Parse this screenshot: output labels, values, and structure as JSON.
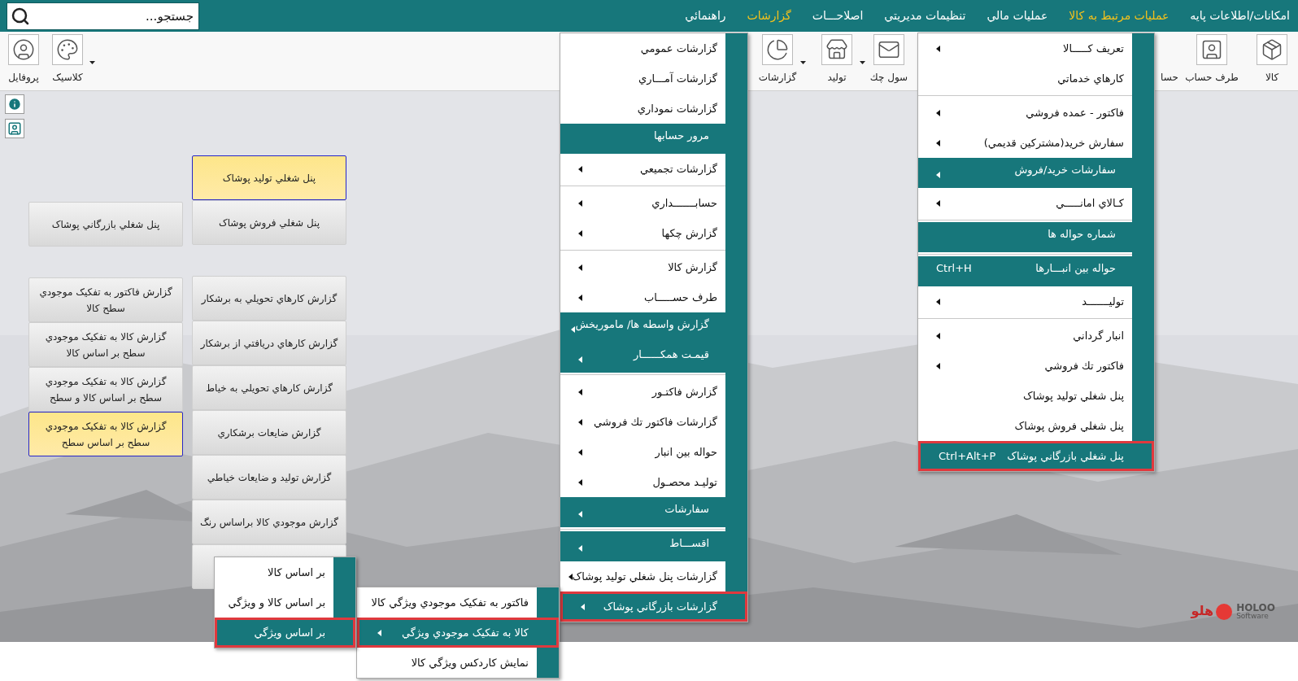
{
  "top_menu": [
    {
      "label": "امکانات/اطلاعات پايه",
      "active": false
    },
    {
      "label": "عمليات مرتبط به كالا",
      "active": true
    },
    {
      "label": "عمليات مالي",
      "active": false
    },
    {
      "label": "تنظيمات مديريتي",
      "active": false
    },
    {
      "label": "اصلاحـــات",
      "active": false
    },
    {
      "label": "گزارشات",
      "active": true
    },
    {
      "label": "راهنمائي",
      "active": false
    }
  ],
  "search": {
    "placeholder": "جستجو..."
  },
  "toolbar": {
    "right": [
      {
        "label": "كالا",
        "dropdown": false
      },
      {
        "label": "طرف حساب",
        "dropdown": false
      },
      {
        "label": "حسا",
        "dropdown": false
      },
      {
        "label": "سول چك",
        "dropdown": false
      },
      {
        "label": "توليد",
        "dropdown": true
      },
      {
        "label": "گزارشات",
        "dropdown": true
      }
    ],
    "left": [
      {
        "label": "كلاسيک",
        "dropdown": true
      },
      {
        "label": "پروفايل",
        "dropdown": false
      }
    ]
  },
  "panel_columns": [
    {
      "groups": [
        [
          {
            "kind": "button",
            "label": "پنل شغلي توليد پوشاک",
            "selected": true
          },
          {
            "kind": "button",
            "label": "پنل شغلي فروش پوشاک",
            "selected": false
          }
        ],
        [
          {
            "kind": "button",
            "label": "گزارش كارهاي تحويلي به برشكار",
            "selected": false
          },
          {
            "kind": "button",
            "label": "گزارش كارهاي دريافتي از برشكار",
            "selected": false
          },
          {
            "kind": "button",
            "label": "گزارش كارهاي تحويلي به خياط",
            "selected": false
          },
          {
            "kind": "button",
            "label": "گزارش ضايعات برشكاري",
            "selected": false
          },
          {
            "kind": "button",
            "label": "گزارش توليد و ضايعات خياطي",
            "selected": false
          },
          {
            "kind": "button",
            "label": "گزارش موجودي كالا براساس رنگ",
            "selected": false
          },
          {
            "kind": "blank",
            "selected": false
          }
        ]
      ]
    },
    {
      "groups": [
        [
          {
            "kind": "button",
            "label": "پنل شغلي بازرگاني پوشاک",
            "selected": false
          }
        ],
        [
          {
            "kind": "button",
            "label": "گزارش فاكتور به تفكيک موجودي سطح كالا",
            "selected": false
          },
          {
            "kind": "button",
            "label": "گزارش كالا به تفكيک موجودي سطح بر اساس كالا",
            "selected": false
          },
          {
            "kind": "button",
            "label": "گزارش كالا به تفكيک موجودي سطح بر اساس كالا و سطح",
            "selected": false
          },
          {
            "kind": "button",
            "label": "گزارش كالا به تفكيک موجودي سطح بر اساس سطح",
            "selected": true
          }
        ]
      ]
    }
  ],
  "menus": [
    {
      "items": [
        {
          "kind": "item",
          "label": "تعريف كـــــالا",
          "submenu": true,
          "selected": false
        },
        {
          "kind": "item",
          "label": "كارهاي خدماتي",
          "submenu": false,
          "selected": false
        },
        {
          "kind": "separator"
        },
        {
          "kind": "item",
          "label": "فاكتور - عمده فروشي",
          "submenu": true,
          "selected": false
        },
        {
          "kind": "item",
          "label": "سفارش خريد(مشتركين قديمي)",
          "submenu": true,
          "selected": false
        },
        {
          "kind": "band",
          "label": "سفارشات خريد/فروش",
          "submenu": true,
          "selected": false
        },
        {
          "kind": "item",
          "label": "كـالاي امانـــــي",
          "submenu": true,
          "selected": false
        },
        {
          "kind": "separator"
        },
        {
          "kind": "band",
          "label": "شماره حواله ها",
          "submenu": false,
          "selected": false
        },
        {
          "kind": "separator"
        },
        {
          "kind": "band",
          "label": "حواله بين انبـــارها",
          "shortcut": "Ctrl+H",
          "submenu": false,
          "selected": false
        },
        {
          "kind": "item",
          "label": "توليـــــــد",
          "submenu": true,
          "selected": false
        },
        {
          "kind": "separator"
        },
        {
          "kind": "item",
          "label": "انبار گرداني",
          "submenu": true,
          "selected": false
        },
        {
          "kind": "item",
          "label": "فاكتور تك فروشي",
          "submenu": true,
          "selected": false
        },
        {
          "kind": "item",
          "label": "پنل شغلي توليد پوشاک",
          "submenu": false,
          "selected": false
        },
        {
          "kind": "item",
          "label": "پنل شغلي فروش پوشاک",
          "submenu": false,
          "selected": false
        },
        {
          "kind": "item",
          "label": "پنل شغلي بازرگاني پوشاک",
          "shortcut": "Ctrl+Alt+P",
          "submenu": false,
          "selected": true
        }
      ]
    },
    {
      "items": [
        {
          "kind": "item",
          "label": "گزارشات عمومي",
          "submenu": false,
          "selected": false
        },
        {
          "kind": "item",
          "label": "گزارشات آمـــاري",
          "submenu": false,
          "selected": false
        },
        {
          "kind": "item",
          "label": "گزارشات نموداري",
          "submenu": false,
          "selected": false
        },
        {
          "kind": "band",
          "label": "مرور حسابها",
          "submenu": false,
          "selected": false
        },
        {
          "kind": "item",
          "label": "گزارشات تجميعي",
          "submenu": true,
          "selected": false
        },
        {
          "kind": "separator"
        },
        {
          "kind": "item",
          "label": "حسابـــــــداري",
          "submenu": true,
          "selected": false
        },
        {
          "kind": "item",
          "label": "گزارش چكها",
          "submenu": true,
          "selected": false
        },
        {
          "kind": "separator"
        },
        {
          "kind": "item",
          "label": "گزارش كالا",
          "submenu": true,
          "selected": false
        },
        {
          "kind": "item",
          "label": "طرف حســـــاب",
          "submenu": true,
          "selected": false
        },
        {
          "kind": "band",
          "label": "گزارش واسطه ها/ ماموريخش",
          "submenu": true,
          "selected": false
        },
        {
          "kind": "band",
          "label": "قيمـت همكــــــار",
          "submenu": true,
          "selected": false
        },
        {
          "kind": "separator"
        },
        {
          "kind": "item",
          "label": "گزارش فاكتـور",
          "submenu": true,
          "selected": false
        },
        {
          "kind": "item",
          "label": "گزارشات فاكتور تك فروشي",
          "submenu": true,
          "selected": false
        },
        {
          "kind": "item",
          "label": "حواله بين انبار",
          "submenu": true,
          "selected": false
        },
        {
          "kind": "item",
          "label": "توليـد محصـول",
          "submenu": true,
          "selected": false
        },
        {
          "kind": "band",
          "label": "سفارشات",
          "submenu": true,
          "selected": false
        },
        {
          "kind": "separator"
        },
        {
          "kind": "band",
          "label": "اقســـاط",
          "submenu": true,
          "selected": false
        },
        {
          "kind": "item",
          "label": "گزارشات پنل شغلي توليد پوشاک",
          "submenu": true,
          "selected": false
        },
        {
          "kind": "item",
          "label": "گزارشات بازرگاني پوشاک",
          "submenu": true,
          "selected": true
        }
      ]
    },
    {
      "items": [
        {
          "kind": "item",
          "label": "فاكتور به تفكيک موجودي ويژگي كالا",
          "submenu": false,
          "selected": false
        },
        {
          "kind": "item",
          "label": "كالا به تفكيک موجودي ويژگي",
          "submenu": true,
          "selected": true
        },
        {
          "kind": "item",
          "label": "نمايش كاردكس ويژگي كالا",
          "submenu": false,
          "selected": false
        }
      ]
    },
    {
      "items": [
        {
          "kind": "item",
          "label": "بر اساس كالا",
          "submenu": false,
          "selected": false
        },
        {
          "kind": "item",
          "label": "بر اساس كالا و ويژگي",
          "submenu": false,
          "selected": false
        },
        {
          "kind": "item",
          "label": "بر اساس ويژگي",
          "submenu": false,
          "selected": true
        }
      ]
    }
  ],
  "logo": {
    "persian": "هلو",
    "name": "HOLOO",
    "subtitle": "Software"
  }
}
